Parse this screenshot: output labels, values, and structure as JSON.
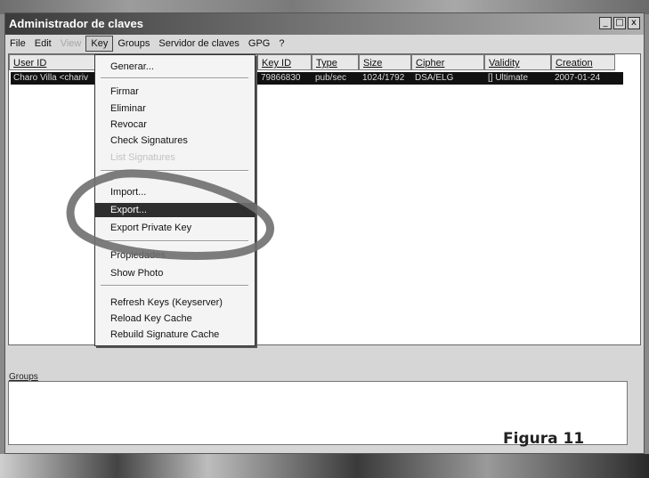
{
  "window": {
    "title": "Administrador de claves",
    "controls": {
      "minimize": "_",
      "maximize": "□",
      "close": "x"
    }
  },
  "menubar": {
    "items": [
      {
        "label": "File",
        "state": "normal"
      },
      {
        "label": "Edit",
        "state": "normal"
      },
      {
        "label": "View",
        "state": "disabled"
      },
      {
        "label": "Key",
        "state": "active"
      },
      {
        "label": "Groups",
        "state": "normal"
      },
      {
        "label": "Servidor de claves",
        "state": "normal"
      },
      {
        "label": "GPG",
        "state": "normal"
      },
      {
        "label": "?",
        "state": "normal"
      }
    ]
  },
  "keylist": {
    "columns": [
      "User ID",
      "Key ID",
      "Type",
      "Size",
      "Cipher",
      "Validity",
      "Creation"
    ],
    "rows": [
      {
        "user_id": "Charo Villa <chariv",
        "key_id": "79866830",
        "type": "pub/sec",
        "size": "1024/1792",
        "cipher": "DSA/ELG",
        "validity": "[] Ultimate",
        "creation": "2007-01-24"
      }
    ]
  },
  "key_menu": {
    "items": [
      {
        "label": "Generar...",
        "state": "normal"
      },
      {
        "label": "Firmar",
        "state": "normal"
      },
      {
        "label": "Eliminar",
        "state": "normal"
      },
      {
        "label": "Revocar",
        "state": "normal"
      },
      {
        "label": "Check Signatures",
        "state": "normal"
      },
      {
        "label": "List Signatures",
        "state": "disabled"
      },
      {
        "label": "Import...",
        "state": "normal"
      },
      {
        "label": "Export...",
        "state": "highlighted"
      },
      {
        "label": "Export Private Key",
        "state": "normal"
      },
      {
        "label": "Propiedades",
        "state": "normal"
      },
      {
        "label": "Show Photo",
        "state": "normal"
      },
      {
        "label": "Refresh Keys (Keyserver)",
        "state": "normal"
      },
      {
        "label": "Reload Key Cache",
        "state": "normal"
      },
      {
        "label": "Rebuild Signature Cache",
        "state": "normal"
      }
    ]
  },
  "groups": {
    "label": "Groups"
  },
  "caption": "Figura 11",
  "colors": {
    "highlight": "#2e2e2e",
    "annotation_ring": "#6f6f6f",
    "selected_row": "#111111"
  }
}
